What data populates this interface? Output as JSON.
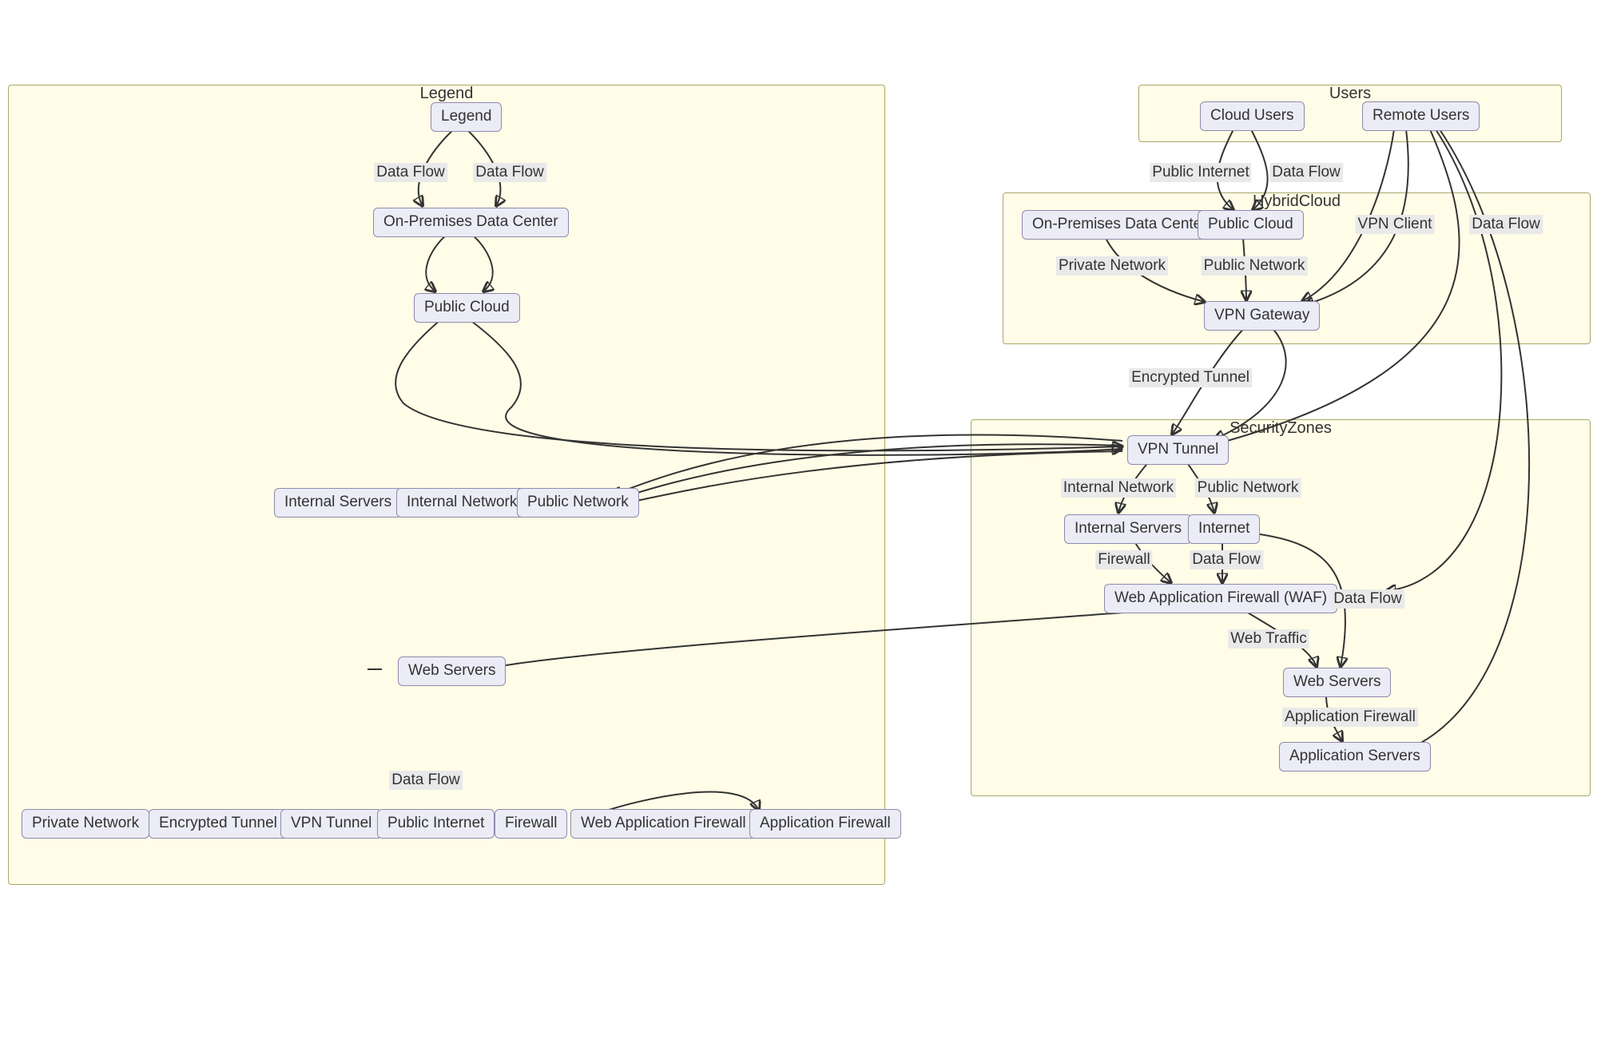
{
  "subgraphs": {
    "legend": {
      "title": "Legend"
    },
    "users": {
      "title": "Users"
    },
    "hybridcloud": {
      "title": "HybridCloud"
    },
    "securityzones": {
      "title": "SecurityZones"
    }
  },
  "nodes": {
    "legend_legend": "Legend",
    "legend_onprem": "On-Premises Data Center",
    "legend_pubcloud": "Public Cloud",
    "legend_intsrv": "Internal Servers",
    "legend_intnet": "Internal Network",
    "legend_pubnet": "Public Network",
    "legend_websrv": "Web Servers",
    "legend_privnet": "Private Network",
    "legend_enct": "Encrypted Tunnel",
    "legend_vpnt": "VPN Tunnel",
    "legend_pubint": "Public Internet",
    "legend_fw": "Firewall",
    "legend_waf": "Web Application Firewall",
    "legend_appfw": "Application Firewall",
    "users_cloud": "Cloud Users",
    "users_remote": "Remote Users",
    "hc_onprem": "On-Premises Data Center",
    "hc_pubcloud": "Public Cloud",
    "hc_vpngw": "VPN Gateway",
    "sz_vpnt": "VPN Tunnel",
    "sz_intsrv": "Internal Servers",
    "sz_internet": "Internet",
    "sz_waf": "Web Application Firewall (WAF)",
    "sz_websrv": "Web Servers",
    "sz_appsrv": "Application Servers"
  },
  "edge_labels": {
    "leg_df1": "Data Flow",
    "leg_df2": "Data Flow",
    "leg_df3": "Data Flow",
    "u_pubint": "Public Internet",
    "u_df": "Data Flow",
    "hc_vpncli": "VPN Client",
    "hc_df": "Data Flow",
    "hc_privnet": "Private Network",
    "hc_pubnet": "Public Network",
    "hc_enct": "Encrypted Tunnel",
    "sz_intnet": "Internal Network",
    "sz_pubnet": "Public Network",
    "sz_fw": "Firewall",
    "sz_df1": "Data Flow",
    "sz_df2": "Data Flow",
    "sz_webt": "Web Traffic",
    "sz_appfw": "Application Firewall"
  }
}
